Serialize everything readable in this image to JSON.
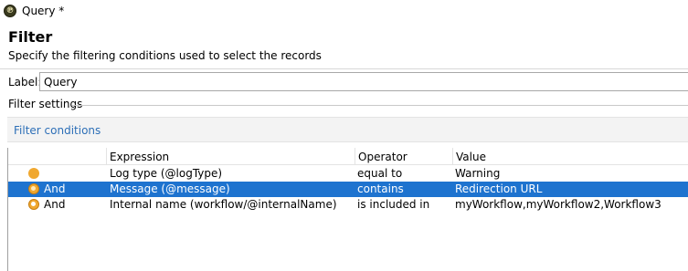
{
  "window": {
    "title": "Query *",
    "icon": "app-logo-icon"
  },
  "header": {
    "title": "Filter",
    "subtitle": "Specify the filtering conditions used to select the records"
  },
  "label_field": {
    "label": "Label:",
    "value": "Query"
  },
  "section": {
    "title": "Filter settings"
  },
  "subpanel": {
    "link": "Filter conditions"
  },
  "grid": {
    "columns": [
      "Expression",
      "Operator",
      "Value"
    ],
    "rows": [
      {
        "conjunction": "",
        "expression": "Log type (@logType)",
        "operator": "equal to",
        "value": "Warning",
        "icon": "condition-dot-icon",
        "selected": false
      },
      {
        "conjunction": "And",
        "expression": "Message (@message)",
        "operator": "contains",
        "value": "Redirection URL",
        "icon": "and-condition-icon",
        "selected": true
      },
      {
        "conjunction": "And",
        "expression": "Internal name (workflow/@internalName)",
        "operator": "is included in",
        "value": "myWorkflow,myWorkflow2,Workflow3",
        "icon": "and-condition-icon",
        "selected": false
      }
    ]
  },
  "colors": {
    "selection": "#1e73cf",
    "link": "#2d6fb7",
    "condition_icon": "#f0a830"
  }
}
